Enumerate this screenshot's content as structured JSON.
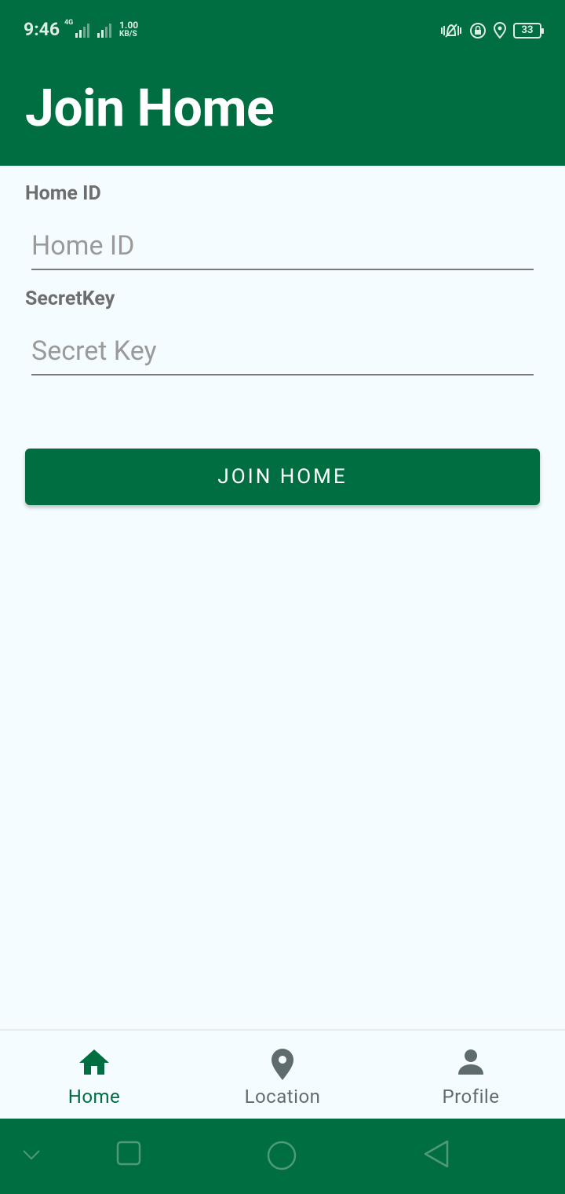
{
  "status_bar": {
    "time": "9:46",
    "network_type": "4G",
    "speed_value": "1.00",
    "speed_unit": "KB/S",
    "battery": "33"
  },
  "header": {
    "title": "Join Home"
  },
  "form": {
    "home_id_label": "Home ID",
    "home_id_placeholder": "Home ID",
    "home_id_value": "",
    "secret_key_label": "SecretKey",
    "secret_key_placeholder": "Secret Key",
    "secret_key_value": "",
    "submit_label": "JOIN HOME"
  },
  "bottom_nav": {
    "items": [
      {
        "label": "Home",
        "icon": "home-icon",
        "active": true
      },
      {
        "label": "Location",
        "icon": "location-pin-icon",
        "active": false
      },
      {
        "label": "Profile",
        "icon": "person-icon",
        "active": false
      }
    ]
  },
  "colors": {
    "primary": "#006E40",
    "background": "#F5FCFF",
    "label_gray": "#6E6E6E",
    "nav_inactive": "#5F6C6F"
  }
}
